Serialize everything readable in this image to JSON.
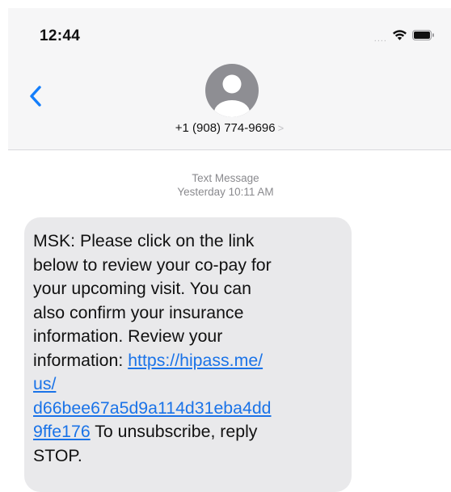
{
  "status_bar": {
    "time": "12:44",
    "signal_dots": "....",
    "wifi_icon": "wifi-icon",
    "battery_icon": "battery-icon"
  },
  "conversation": {
    "contact_number": "+1 (908) 774-9696",
    "contact_chevron": ">",
    "message_type": "Text Message",
    "timestamp": "Yesterday 10:11 AM"
  },
  "message": {
    "text_before_link": "MSK: Please click on the link\nbelow to review your co-pay for\nyour upcoming visit.  You can\nalso confirm your insurance\ninformation. Review your\ninformation: ",
    "link": "https://hipass.me/\nus/\nd66bee67a5d9a114d31eba4dd\n9ffe176",
    "text_after_link": " To unsubscribe, reply\nSTOP."
  },
  "colors": {
    "accent": "#1a73e8",
    "bubble": "#e9e9eb",
    "header": "#f6f6f7",
    "back": "#147efb"
  }
}
